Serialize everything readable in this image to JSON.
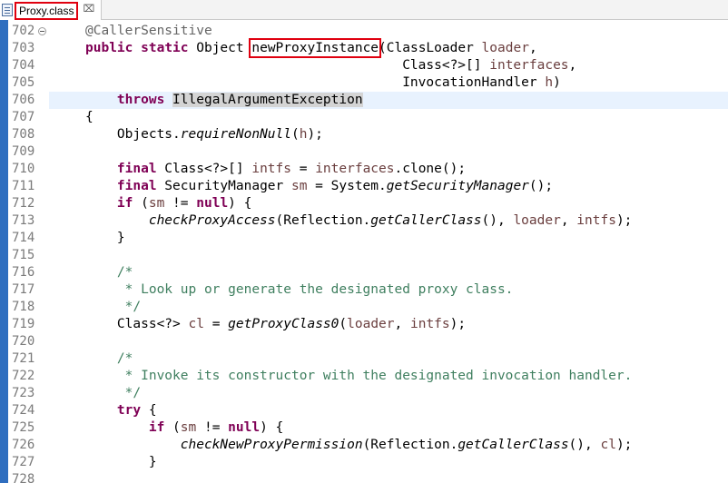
{
  "tab": {
    "title": "Proxy.class",
    "close_glyph": "⌧"
  },
  "gutter": {
    "line_numbers": [
      "702",
      "703",
      "704",
      "705",
      "706",
      "707",
      "708",
      "709",
      "710",
      "711",
      "712",
      "713",
      "714",
      "715",
      "716",
      "717",
      "718",
      "719",
      "720",
      "721",
      "722",
      "723",
      "724",
      "725",
      "726",
      "727",
      "728"
    ]
  },
  "code": {
    "lines": [
      [
        {
          "t": "@CallerSensitive",
          "c": "ann"
        }
      ],
      [
        {
          "t": "public",
          "c": "kw"
        },
        {
          "t": " "
        },
        {
          "t": "static",
          "c": "kw"
        },
        {
          "t": " Object "
        },
        {
          "t": "newProxyInstance",
          "c": "hl-box"
        },
        {
          "t": "("
        },
        {
          "t": "ClassLoader "
        },
        {
          "t": "loader",
          "c": "param"
        },
        {
          "t": ","
        }
      ],
      [
        {
          "t": "                                        "
        },
        {
          "t": "Class<?>[] "
        },
        {
          "t": "interfaces",
          "c": "param"
        },
        {
          "t": ","
        }
      ],
      [
        {
          "t": "                                        "
        },
        {
          "t": "InvocationHandler "
        },
        {
          "t": "h",
          "c": "param"
        },
        {
          "t": ")"
        }
      ],
      [
        {
          "t": "    "
        },
        {
          "t": "throws",
          "c": "kw"
        },
        {
          "t": " "
        },
        {
          "t": "IllegalArgumentException",
          "c": "occurrence"
        }
      ],
      [
        {
          "t": "{"
        }
      ],
      [
        {
          "t": "    Objects."
        },
        {
          "t": "requireNonNull",
          "c": "static"
        },
        {
          "t": "("
        },
        {
          "t": "h",
          "c": "param"
        },
        {
          "t": ");"
        }
      ],
      [],
      [
        {
          "t": "    "
        },
        {
          "t": "final",
          "c": "kw"
        },
        {
          "t": " Class<?>[] "
        },
        {
          "t": "intfs",
          "c": "var"
        },
        {
          "t": " = "
        },
        {
          "t": "interfaces",
          "c": "param"
        },
        {
          "t": ".clone();"
        }
      ],
      [
        {
          "t": "    "
        },
        {
          "t": "final",
          "c": "kw"
        },
        {
          "t": " SecurityManager "
        },
        {
          "t": "sm",
          "c": "var"
        },
        {
          "t": " = System."
        },
        {
          "t": "getSecurityManager",
          "c": "static"
        },
        {
          "t": "();"
        }
      ],
      [
        {
          "t": "    "
        },
        {
          "t": "if",
          "c": "kw"
        },
        {
          "t": " ("
        },
        {
          "t": "sm",
          "c": "var"
        },
        {
          "t": " != "
        },
        {
          "t": "null",
          "c": "kw"
        },
        {
          "t": ") {"
        }
      ],
      [
        {
          "t": "        "
        },
        {
          "t": "checkProxyAccess",
          "c": "static"
        },
        {
          "t": "(Reflection."
        },
        {
          "t": "getCallerClass",
          "c": "static"
        },
        {
          "t": "(), "
        },
        {
          "t": "loader",
          "c": "param"
        },
        {
          "t": ", "
        },
        {
          "t": "intfs",
          "c": "var"
        },
        {
          "t": ");"
        }
      ],
      [
        {
          "t": "    }"
        }
      ],
      [],
      [
        {
          "t": "    "
        },
        {
          "t": "/*",
          "c": "comment"
        }
      ],
      [
        {
          "t": "     * Look up or generate the designated proxy class.",
          "c": "comment"
        }
      ],
      [
        {
          "t": "     */",
          "c": "comment"
        }
      ],
      [
        {
          "t": "    Class<?> "
        },
        {
          "t": "cl",
          "c": "var"
        },
        {
          "t": " = "
        },
        {
          "t": "getProxyClass0",
          "c": "static"
        },
        {
          "t": "("
        },
        {
          "t": "loader",
          "c": "param"
        },
        {
          "t": ", "
        },
        {
          "t": "intfs",
          "c": "var"
        },
        {
          "t": ");"
        }
      ],
      [],
      [
        {
          "t": "    "
        },
        {
          "t": "/*",
          "c": "comment"
        }
      ],
      [
        {
          "t": "     * Invoke its constructor with the designated invocation handler.",
          "c": "comment"
        }
      ],
      [
        {
          "t": "     */",
          "c": "comment"
        }
      ],
      [
        {
          "t": "    "
        },
        {
          "t": "try",
          "c": "kw"
        },
        {
          "t": " {"
        }
      ],
      [
        {
          "t": "        "
        },
        {
          "t": "if",
          "c": "kw"
        },
        {
          "t": " ("
        },
        {
          "t": "sm",
          "c": "var"
        },
        {
          "t": " != "
        },
        {
          "t": "null",
          "c": "kw"
        },
        {
          "t": ") {"
        }
      ],
      [
        {
          "t": "            "
        },
        {
          "t": "checkNewProxyPermission",
          "c": "static"
        },
        {
          "t": "(Reflection."
        },
        {
          "t": "getCallerClass",
          "c": "static"
        },
        {
          "t": "(), "
        },
        {
          "t": "cl",
          "c": "var"
        },
        {
          "t": ");"
        }
      ],
      [
        {
          "t": "        }"
        }
      ],
      []
    ]
  }
}
